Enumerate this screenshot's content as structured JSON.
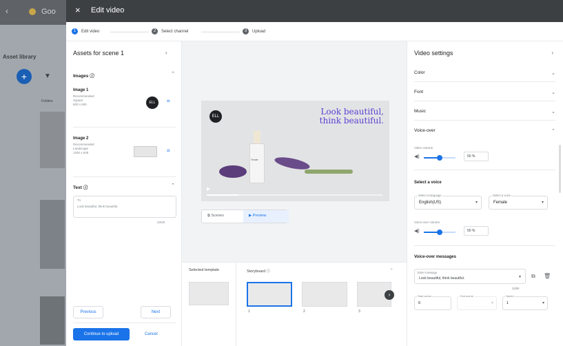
{
  "background": {
    "app_title": "Goo",
    "library_label": "Asset library",
    "add_label": "+",
    "folder_label": "Folders",
    "asset_1_label": "",
    "asset_2_label": "",
    "asset_3_label": ""
  },
  "modal": {
    "title": "Edit video",
    "close_glyph": "×"
  },
  "stepper": {
    "steps": [
      {
        "num": "1",
        "label": "Edit video"
      },
      {
        "num": "2",
        "label": "Select channel"
      },
      {
        "num": "3",
        "label": "Upload"
      }
    ]
  },
  "assets_panel": {
    "title": "Assets for scene 1",
    "images_label": "Images ⓘ",
    "image1": {
      "title": "Image 1",
      "meta": [
        "Recommended",
        "Square",
        "600 x 600"
      ]
    },
    "image2": {
      "title": "Image 2",
      "meta": [
        "Recommended",
        "Landscape",
        "1200 x 628"
      ]
    },
    "text_label": "Text ⓘ",
    "text_field": {
      "label": "T1",
      "value": "Look beautiful, think beautiful.",
      "count": "33/40"
    },
    "previous_label": "Previous",
    "next_label": "Next",
    "continue_label": "Continue to upload",
    "cancel_label": "Cancel"
  },
  "preview": {
    "headline_line1": "Look beautiful,",
    "headline_line2": "think beautiful.",
    "logo_text": "ELL",
    "bottle_text": "Tender",
    "progress": 0.18,
    "scenes_label": "Scenes",
    "preview_label": "Preview"
  },
  "storyboard": {
    "selected_template_label": "Selected template",
    "storyboard_label": "Storyboard ⓘ",
    "scene_numbers": [
      "1",
      "2",
      "3"
    ]
  },
  "settings": {
    "title": "Video settings",
    "color_label": "Color",
    "font_label": "Font",
    "music_label": "Music",
    "voice_over_label": "Voice-over",
    "video_volume_label": "Video volume",
    "video_volume_value": "50",
    "video_volume_level": 0.5,
    "select_voice_label": "Select a voice",
    "language_label": "Select a language",
    "language_value": "English(US)",
    "voice_label": "Select a voice",
    "voice_value": "Female",
    "voiceover_volume_label": "Voice-over volume",
    "voiceover_volume_value": "50",
    "voiceover_volume_level": 0.5,
    "vo_messages_label": "Voice-over messages",
    "enter_message_label": "Enter message",
    "message_value": "Look beautiful, think beautiful.",
    "message_count": "33/80",
    "start_label": "Start scene",
    "start_value": "0",
    "end_label": "End scene",
    "end_value": "",
    "speed_label": "Speed",
    "speed_value": "1"
  }
}
